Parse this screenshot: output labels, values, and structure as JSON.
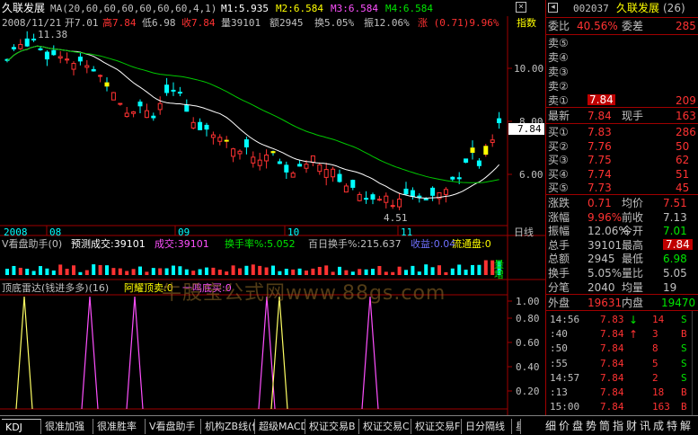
{
  "stock": {
    "name": "久联发展",
    "code": "002037",
    "tab_count": "(26)"
  },
  "main_header": {
    "ma_text": "MA(20,60,60,60,60,60,60,4,1)",
    "m1": "M1:5.935",
    "m2": "M2:6.584",
    "m3": "M3:6.584",
    "m4": "M4:6.584"
  },
  "info_line": {
    "date": "2008/11/21",
    "open": "开7.01",
    "high": "高7.84",
    "low": "低6.98",
    "close": "收7.84",
    "volume": "量39101",
    "amount": "额2945",
    "turnover": "换5.05%",
    "amplitude": "振12.06%",
    "change": "涨 (0.71)9.96%",
    "index": "指数"
  },
  "price_axis": {
    "labels": [
      "10.00",
      "8.00",
      "6.00"
    ],
    "current": "7.84"
  },
  "annotations": {
    "high_mark": "11.38",
    "low_mark": "4.51"
  },
  "date_axis": {
    "labels": [
      "2008",
      "08",
      "09",
      "10",
      "11"
    ],
    "period": "日线"
  },
  "volume_panel": {
    "title": "V看盘助手(0)",
    "predicted": "预测成交:39101",
    "volume": "成交:39101",
    "turnover": "换手率%:5.052",
    "turnover100": "百日换手%:215.637",
    "accum": "收益:0.04",
    "float": "流通盘:0",
    "side_top": "量",
    "side_bottom": "增"
  },
  "radar_panel": {
    "title": "顶底雷达(钱进多多)(16)",
    "buy_signal": "阿耀顶卖:0",
    "sell_signal": "一鸣底买:0",
    "axis": [
      "1.00",
      "0.80",
      "0.60",
      "0.40",
      "0.20"
    ],
    "watermark": "牛股宝公式网www.88gs.com"
  },
  "order_book": {
    "ratio_label": "委比",
    "ratio_value": "40.56%",
    "diff_label": "委差",
    "diff_value": "285",
    "sells": [
      {
        "label": "卖⑤",
        "price": "",
        "vol": ""
      },
      {
        "label": "卖④",
        "price": "",
        "vol": ""
      },
      {
        "label": "卖③",
        "price": "",
        "vol": ""
      },
      {
        "label": "卖②",
        "price": "",
        "vol": ""
      },
      {
        "label": "卖①",
        "price": "7.84",
        "vol": "209"
      }
    ],
    "latest_label": "最新",
    "latest_value": "7.84",
    "hand_label": "现手",
    "hand_value": "163",
    "buys": [
      {
        "label": "买①",
        "price": "7.83",
        "vol": "286"
      },
      {
        "label": "买②",
        "price": "7.76",
        "vol": "50"
      },
      {
        "label": "买③",
        "price": "7.75",
        "vol": "62"
      },
      {
        "label": "买④",
        "price": "7.74",
        "vol": "51"
      },
      {
        "label": "买⑤",
        "price": "7.73",
        "vol": "45"
      }
    ]
  },
  "stats": [
    {
      "l1": "涨跌",
      "v1": "0.71",
      "c1": "red",
      "l2": "均价",
      "v2": "7.51",
      "c2": "red"
    },
    {
      "l1": "涨幅",
      "v1": "9.96%",
      "c1": "red",
      "l2": "前收",
      "v2": "7.13",
      "c2": "gray"
    },
    {
      "l1": "振幅",
      "v1": "12.06%",
      "c1": "gray",
      "l2": "今开",
      "v2": "7.01",
      "c2": "green"
    },
    {
      "l1": "总手",
      "v1": "39101",
      "c1": "gray",
      "l2": "最高",
      "v2": "7.84",
      "c2": "hi"
    },
    {
      "l1": "总额",
      "v1": "2945",
      "c1": "gray",
      "l2": "最低",
      "v2": "6.98",
      "c2": "green"
    },
    {
      "l1": "换手",
      "v1": "5.05%",
      "c1": "gray",
      "l2": "量比",
      "v2": "5.05",
      "c2": "gray"
    },
    {
      "l1": "分笔",
      "v1": "2040",
      "c1": "gray",
      "l2": "均量",
      "v2": "19",
      "c2": "gray"
    }
  ],
  "outer_inner": {
    "outer_label": "外盘",
    "outer_value": "19631",
    "inner_label": "内盘",
    "inner_value": "19470"
  },
  "ticks": [
    {
      "time": "14:56",
      "price": "7.83",
      "arrow": "↓",
      "vol": "14",
      "bs": "S",
      "pc": "red",
      "ac": "green"
    },
    {
      "time": ":40",
      "price": "7.84",
      "arrow": "↑",
      "vol": "3",
      "bs": "B",
      "pc": "red",
      "ac": "red"
    },
    {
      "time": ":50",
      "price": "7.84",
      "arrow": "",
      "vol": "8",
      "bs": "S",
      "pc": "red",
      "ac": "red"
    },
    {
      "time": ":55",
      "price": "7.84",
      "arrow": "",
      "vol": "5",
      "bs": "S",
      "pc": "red",
      "ac": "red"
    },
    {
      "time": "14:57",
      "price": "7.84",
      "arrow": "",
      "vol": "2",
      "bs": "S",
      "pc": "red",
      "ac": "red"
    },
    {
      "time": ":13",
      "price": "7.84",
      "arrow": "",
      "vol": "18",
      "bs": "B",
      "pc": "red",
      "ac": "red"
    },
    {
      "time": "15:00",
      "price": "7.84",
      "arrow": "",
      "vol": "163",
      "bs": "B",
      "pc": "red",
      "ac": "red"
    }
  ],
  "tabs": [
    "KDJ",
    "很准加强",
    "很准胜率",
    "V看盘助手",
    "机构ZB线(修V",
    "超级MACD",
    "权证交易B",
    "权证交易C",
    "权证交易F",
    "日分隔线",
    "星"
  ],
  "side_tabs": [
    "细",
    "价",
    "盘",
    "势",
    "筒",
    "指",
    "财",
    "讯",
    "成",
    "特",
    "解"
  ],
  "colors": {
    "up": "#ff3232",
    "down": "#00ffff",
    "ma1": "#ffffff",
    "ma2": "#00c800",
    "radar_buy": "#ffff64",
    "radar_sell": "#ff50ff",
    "border": "#a00000"
  }
}
